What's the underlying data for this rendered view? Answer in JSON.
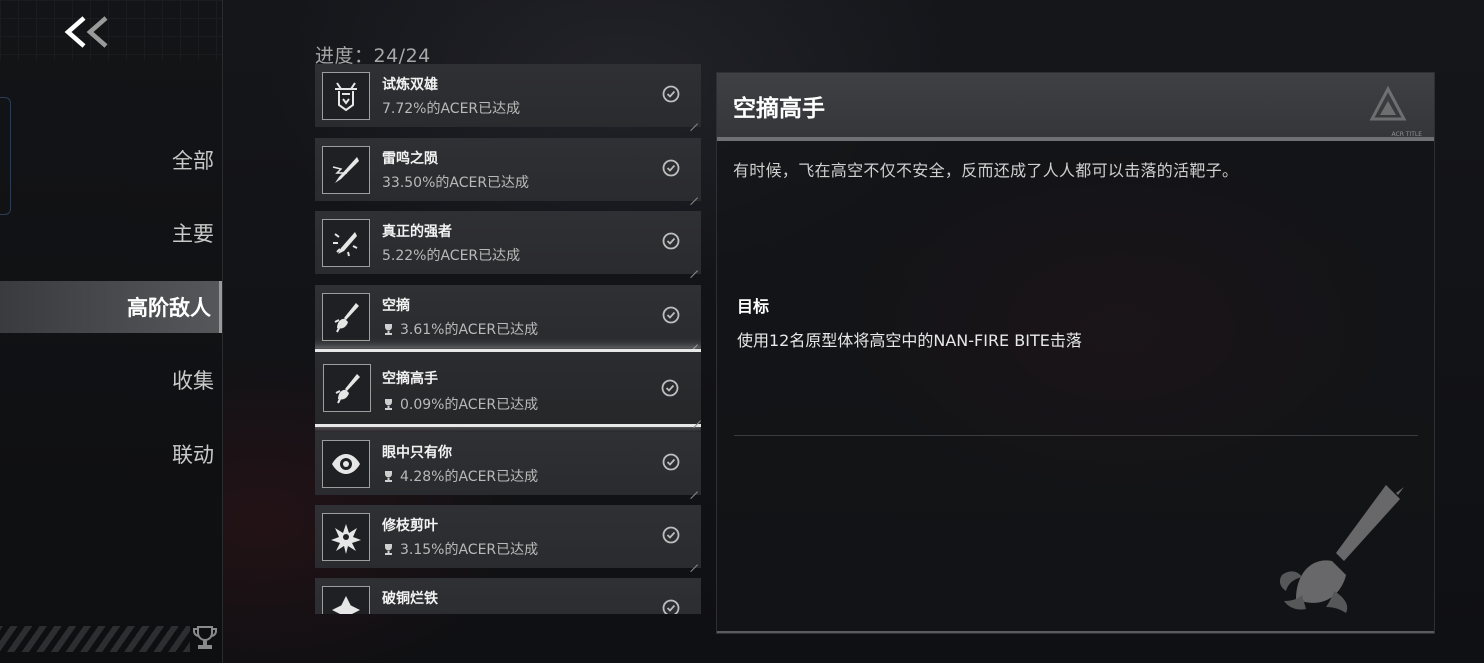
{
  "nav": {
    "back_icon": "double-chevron-left-icon",
    "items": [
      {
        "label": "全部",
        "active": false
      },
      {
        "label": "主要",
        "active": false
      },
      {
        "label": "高阶敌人",
        "active": true
      },
      {
        "label": "收集",
        "active": false
      },
      {
        "label": "联动",
        "active": false
      }
    ],
    "footer_icon": "trophy-icon"
  },
  "progress": {
    "text": "进度：24/24"
  },
  "achievements": [
    {
      "name": "试炼双雄",
      "rate": "7.72%的ACER已达成",
      "icon": "twin-knights-icon",
      "trophy": false,
      "completed": true
    },
    {
      "name": "雷鸣之陨",
      "rate": "33.50%的ACER已达成",
      "icon": "lightning-blade-icon",
      "trophy": false,
      "completed": true
    },
    {
      "name": "真正的强者",
      "rate": "5.22%的ACER已达成",
      "icon": "burst-sword-icon",
      "trophy": false,
      "completed": true
    },
    {
      "name": "空摘",
      "rate": "3.61%的ACER已达成",
      "icon": "sword-hand-icon",
      "trophy": true,
      "completed": true
    },
    {
      "name": "空摘高手",
      "rate": "0.09%的ACER已达成",
      "icon": "sword-hand-icon",
      "trophy": true,
      "completed": true,
      "selected": true
    },
    {
      "name": "眼中只有你",
      "rate": "4.28%的ACER已达成",
      "icon": "eye-icon",
      "trophy": true,
      "completed": true
    },
    {
      "name": "修枝剪叶",
      "rate": "3.15%的ACER已达成",
      "icon": "shattered-flower-icon",
      "trophy": true,
      "completed": true
    },
    {
      "name": "破铜烂铁",
      "rate": "",
      "icon": "four-petal-icon",
      "trophy": false,
      "completed": true
    }
  ],
  "detail": {
    "title": "空摘高手",
    "description": "有时候，飞在高空不仅不安全，反而还成了人人都可以击落的活靶子。",
    "goal_label": "目标",
    "goal_text": "使用12名原型体将高空中的NAN-FIRE BITE击落",
    "emblem_icon": "game-logo-icon",
    "emblem_label": "ACR TITLE",
    "big_icon": "sword-hand-icon"
  },
  "colors": {
    "background": "#0d0e10",
    "card": "#2f3034",
    "selected_border": "#e8e8e8",
    "active_nav": "#56575b"
  }
}
